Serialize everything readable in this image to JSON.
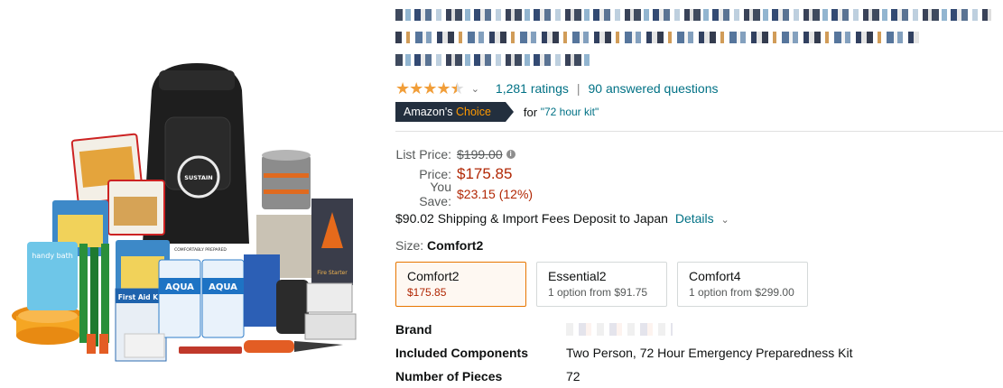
{
  "product": {
    "rating": {
      "stars_value": 4.5,
      "ratings_count": "1,281 ratings",
      "separator": "|",
      "answered": "90 answered questions"
    },
    "badge": {
      "prefix": "Amazon's",
      "choice": "Choice",
      "for_text": "for",
      "keyword": "\"72 hour kit\""
    },
    "pricing": {
      "list_label": "List Price:",
      "list_price": "$199.00",
      "price_label": "Price:",
      "price": "$175.85",
      "save_label": "You Save:",
      "save_value": "$23.15 (12%)"
    },
    "shipping": {
      "text": "$90.02 Shipping & Import Fees Deposit to Japan",
      "details_link": "Details"
    },
    "size": {
      "label": "Size:",
      "selected": "Comfort2"
    },
    "variations": [
      {
        "name": "Comfort2",
        "price": "$175.85"
      },
      {
        "name": "Essential2",
        "sub": "1 option from $91.75"
      },
      {
        "name": "Comfort4",
        "sub": "1 option from $299.00"
      }
    ],
    "specs": [
      {
        "key": "Brand",
        "value": ""
      },
      {
        "key": "Included Components",
        "value": "Two Person, 72 Hour Emergency Preparedness Kit"
      },
      {
        "key": "Number of Pieces",
        "value": "72"
      }
    ],
    "image_labels": {
      "backpack_logo": "SUSTAIN",
      "backpack_tag": "COMFORTABLY PREPARED",
      "water": "AQUA",
      "first_aid": "First Aid Kit",
      "handy_bath": "handy bath",
      "fire_starter": "Fire Starter"
    }
  },
  "colors": {
    "price_red": "#B12704",
    "link_teal": "#007185",
    "badge_dark": "#232F3E",
    "badge_orange": "#FF9900",
    "star_orange": "#F19E39",
    "selected_border": "#E77600"
  }
}
